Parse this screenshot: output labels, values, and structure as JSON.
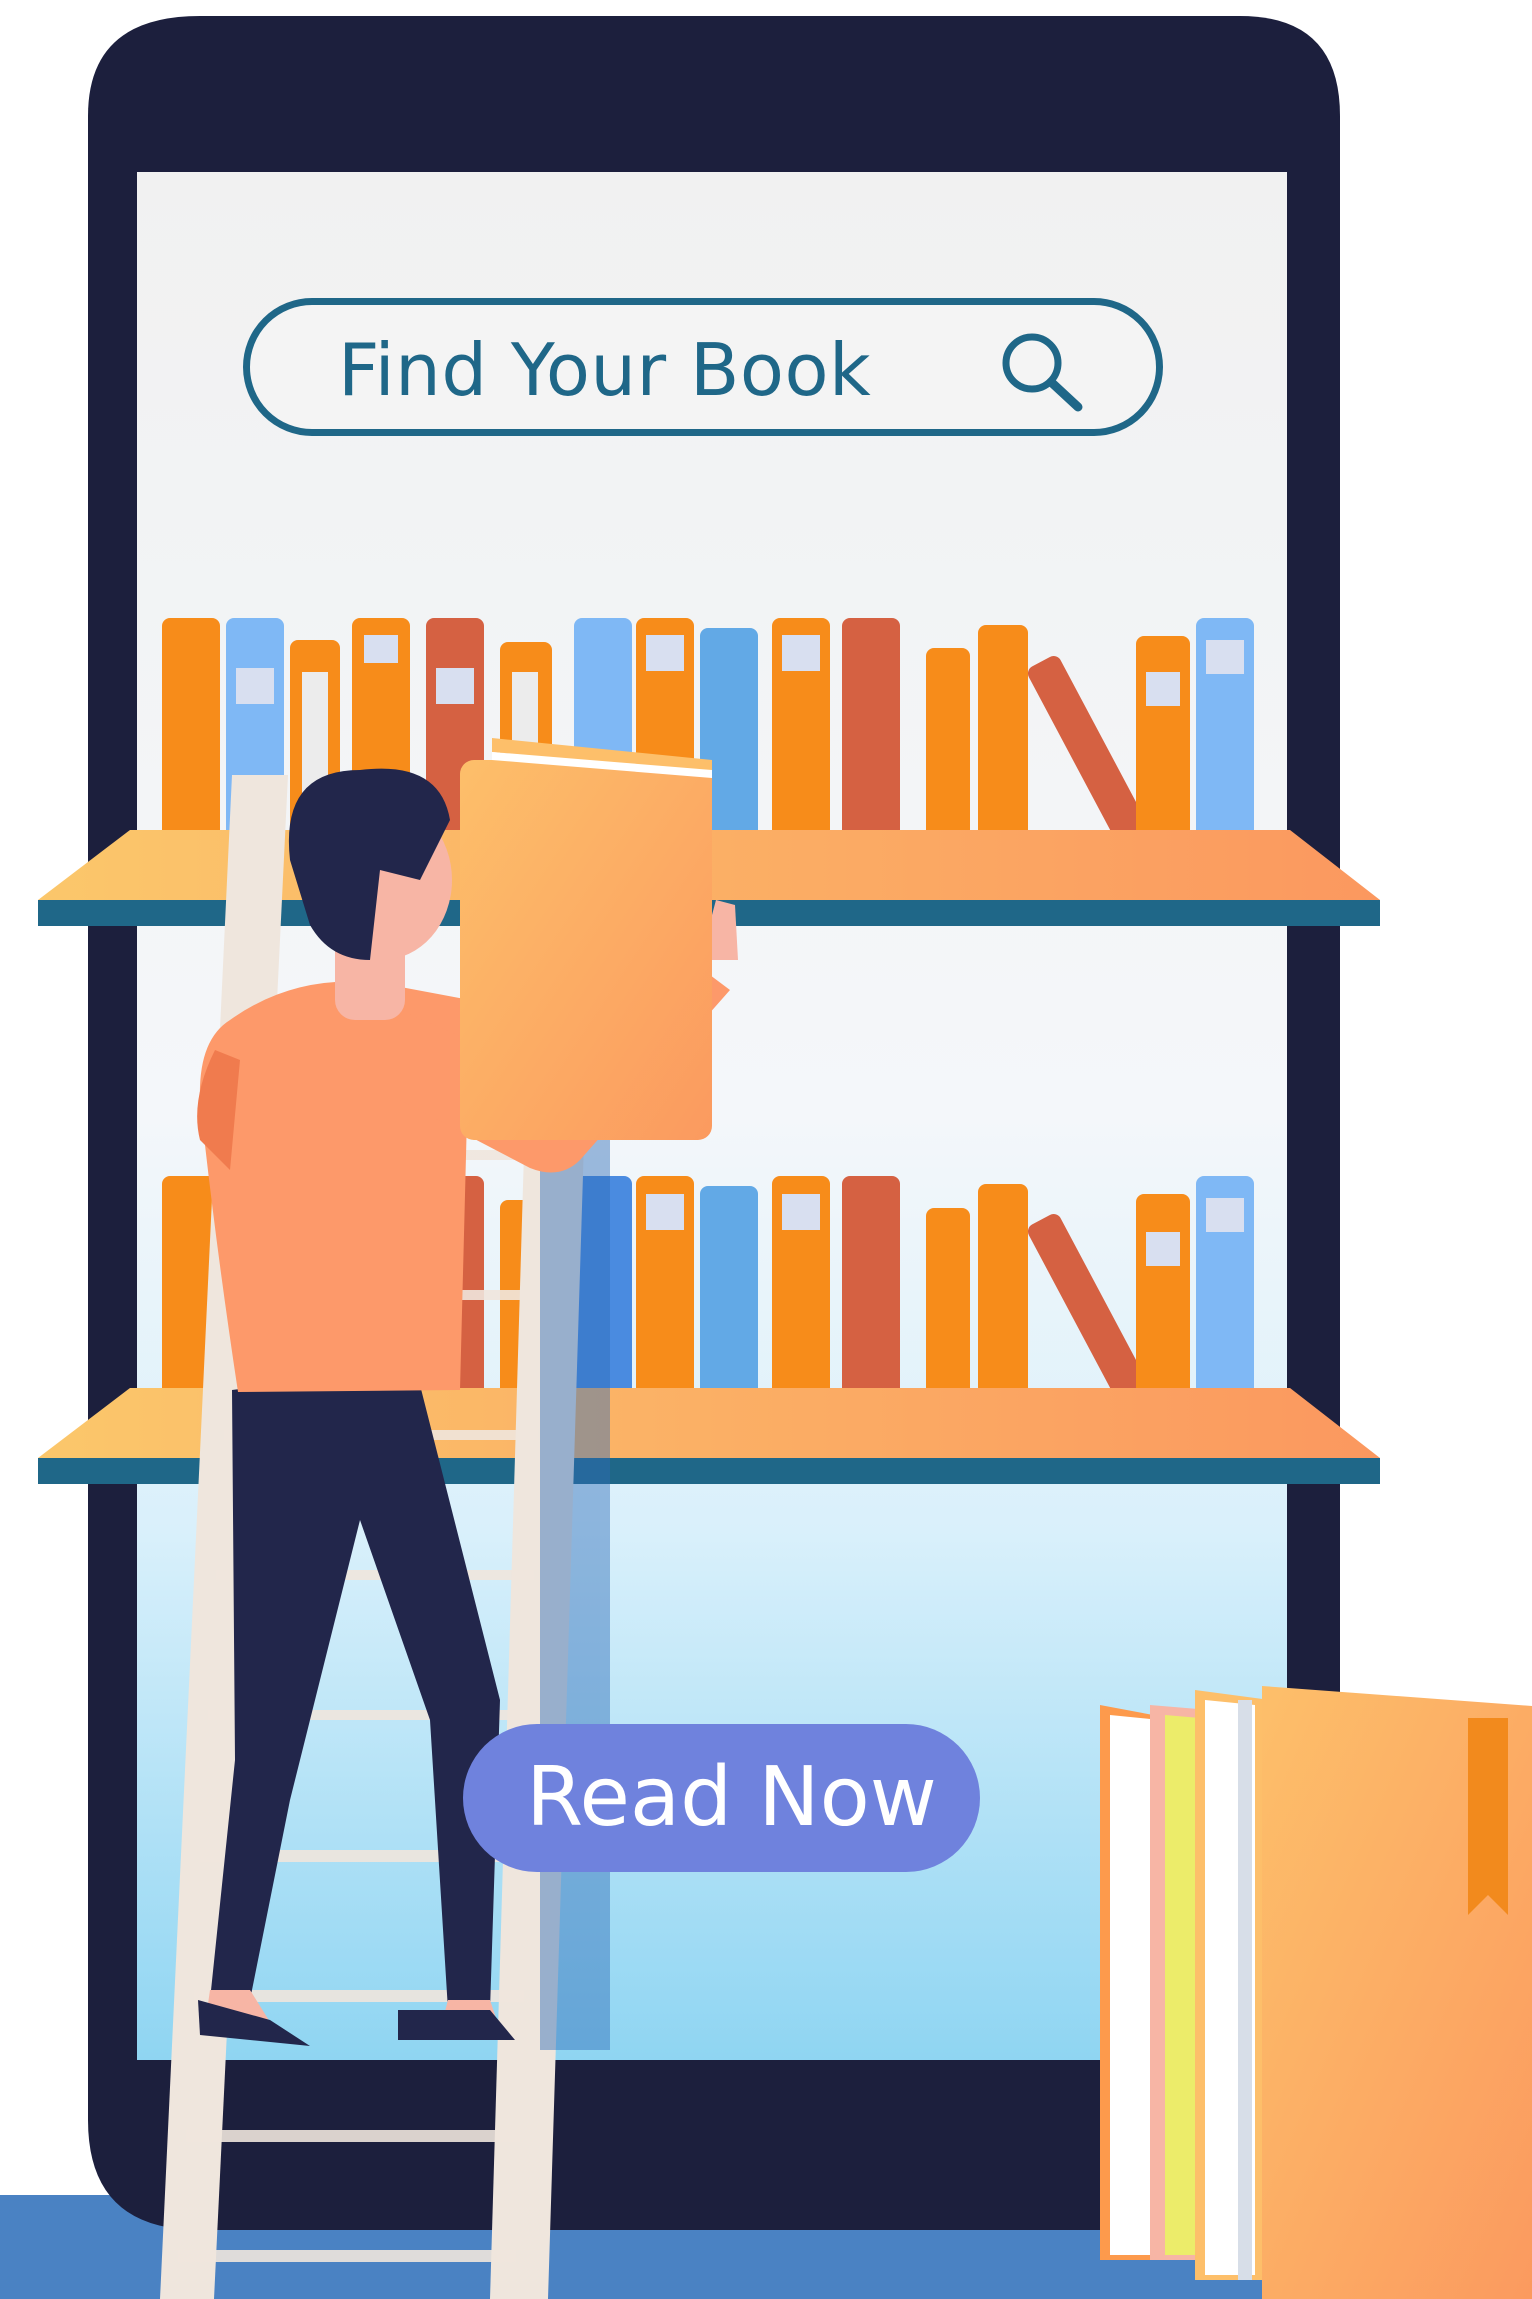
{
  "search": {
    "placeholder": "Find Your Book",
    "icon": "search-icon"
  },
  "cta": {
    "label": "Read Now"
  },
  "colors": {
    "phone_frame": "#1c1f3d",
    "accent_blue": "#1f6788",
    "button": "#6f82dd",
    "book_orange": "#f78c1a",
    "book_blue": "#7fb8f5",
    "book_red": "#d56142",
    "person_shirt": "#fd996a",
    "person_pants": "#22264b",
    "ladder": "#efe6dd",
    "floor": "#4a82c3"
  }
}
